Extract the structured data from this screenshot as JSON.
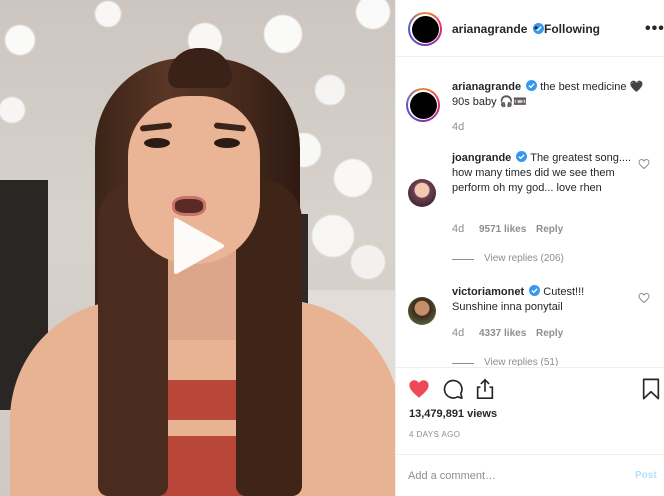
{
  "header": {
    "username": "arianagrande",
    "separator": "•",
    "follow_state": "Following",
    "more_icon": "•••"
  },
  "caption": {
    "username": "arianagrande",
    "line1": "the best medicine 🖤",
    "line2": "90s baby 🎧📼",
    "age": "4d"
  },
  "comments": [
    {
      "username": "joangrande",
      "text": "The greatest song.... how many times did we see them perform oh my god... love rhen",
      "age": "4d",
      "likes": "9571 likes",
      "reply_label": "Reply",
      "view_replies": "View replies (206)"
    },
    {
      "username": "victoriamonet",
      "text_line1": "Cutest!!!",
      "text_line2": "Sunshine inna ponytail",
      "age": "4d",
      "likes": "4337 likes",
      "reply_label": "Reply",
      "view_replies": "View replies (51)"
    }
  ],
  "actions": {
    "views": "13,479,891 views",
    "date": "4 DAYS AGO"
  },
  "composer": {
    "placeholder": "Add a comment…",
    "post_label": "Post"
  },
  "colors": {
    "liked_heart": "#ed4956",
    "verified": "#3897f0",
    "post_disabled": "#b2dffc",
    "muted_text": "#8e8e8e"
  },
  "icons": {
    "play": "play-icon",
    "like": "heart-icon",
    "comment": "comment-icon",
    "share": "share-icon",
    "save": "bookmark-icon",
    "verified": "verified-badge-icon",
    "more": "more-options-icon"
  }
}
